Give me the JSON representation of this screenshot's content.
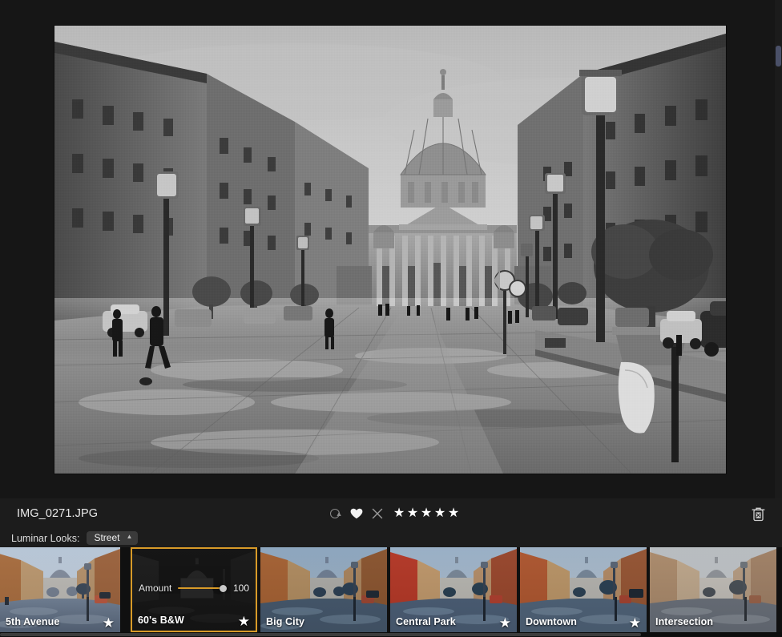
{
  "app": {
    "accent_color": "#d79a28",
    "background_color": "#141414",
    "panel_color": "#1c1c1c"
  },
  "canvas": {
    "photo_alt": "Black and white photograph of a wet cobblestone street leading to St. Peter's Basilica dome with street lamps, trees and parked cars"
  },
  "info_bar": {
    "file_name": "IMG_0271.JPG",
    "unflag_icon": "circle-caret-icon",
    "favorite_icon": "heart-icon",
    "reject_icon": "x-icon",
    "delete_icon": "trash-icon",
    "rating": 5,
    "max_rating": 5,
    "star_icon": "star-icon"
  },
  "looks": {
    "label": "Luminar Looks:",
    "category": "Street",
    "category_caret_icon": "chevron-up-icon"
  },
  "presets": [
    {
      "name": "5th Avenue",
      "selected": false,
      "favorited": true,
      "star_icon": "star-icon"
    },
    {
      "name": "60's B&W",
      "selected": true,
      "favorited": true,
      "star_icon": "star-icon",
      "amount_label": "Amount",
      "amount_value": "100"
    },
    {
      "name": "Big City",
      "selected": false,
      "favorited": false
    },
    {
      "name": "Central Park",
      "selected": false,
      "favorited": true,
      "star_icon": "star-icon"
    },
    {
      "name": "Downtown",
      "selected": false,
      "favorited": true,
      "star_icon": "star-icon"
    },
    {
      "name": "Intersection",
      "selected": false,
      "favorited": false
    }
  ]
}
